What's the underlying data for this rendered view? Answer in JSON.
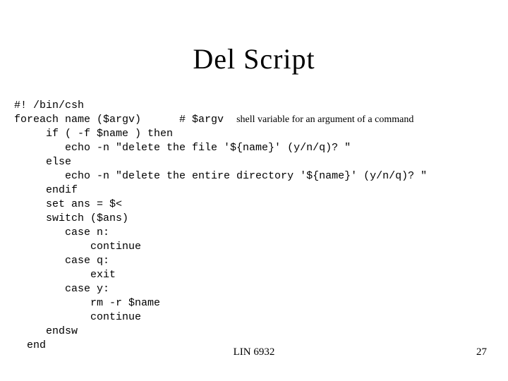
{
  "title": "Del  Script",
  "code": {
    "l1": "#! /bin/csh",
    "l2a": "foreach name ($argv)      # $argv  ",
    "l2b": "shell variable for an argument of a command",
    "l3": "     if ( -f $name ) then",
    "l4": "        echo -n \"delete the file '${name}' (y/n/q)? \"",
    "l5": "     else",
    "l6": "        echo -n \"delete the entire directory '${name}' (y/n/q)? \"",
    "l7": "     endif",
    "l8": "     set ans = $<",
    "l9": "     switch ($ans)",
    "l10": "        case n:",
    "l11": "            continue",
    "l12": "        case q:",
    "l13": "            exit",
    "l14": "        case y:",
    "l15": "            rm -r $name",
    "l16": "            continue",
    "l17": "     endsw",
    "l18": "  end"
  },
  "footer_center": "LIN 6932",
  "footer_right": "27"
}
